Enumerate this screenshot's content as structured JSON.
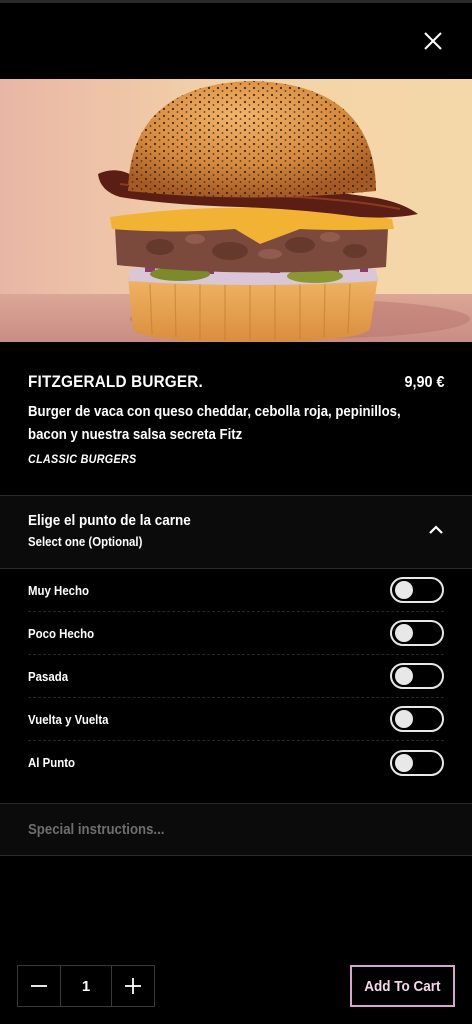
{
  "product": {
    "title": "FITZGERALD BURGER.",
    "price": "9,90 €",
    "description": "Burger de vaca con queso cheddar, cebolla roja, pepinillos, bacon y nuestra salsa secreta Fitz",
    "category": "CLASSIC BURGERS",
    "image_icon": "burger-photo"
  },
  "options": {
    "title": "Elige el punto de la carne",
    "subtitle": "Select one (Optional)",
    "expanded": true,
    "items": [
      {
        "label": "Muy Hecho",
        "selected": false
      },
      {
        "label": "Poco Hecho",
        "selected": false
      },
      {
        "label": "Pasada",
        "selected": false
      },
      {
        "label": "Vuelta y Vuelta",
        "selected": false
      },
      {
        "label": "Al Punto",
        "selected": false
      }
    ]
  },
  "special_instructions": {
    "placeholder": "Special instructions...",
    "value": ""
  },
  "cart": {
    "quantity": "1",
    "add_label": "Add To Cart"
  },
  "colors": {
    "background": "#000000",
    "panel": "#0b0b0b",
    "accent_border": "#d9a6c9",
    "accent_text": "#f4d9ea"
  }
}
